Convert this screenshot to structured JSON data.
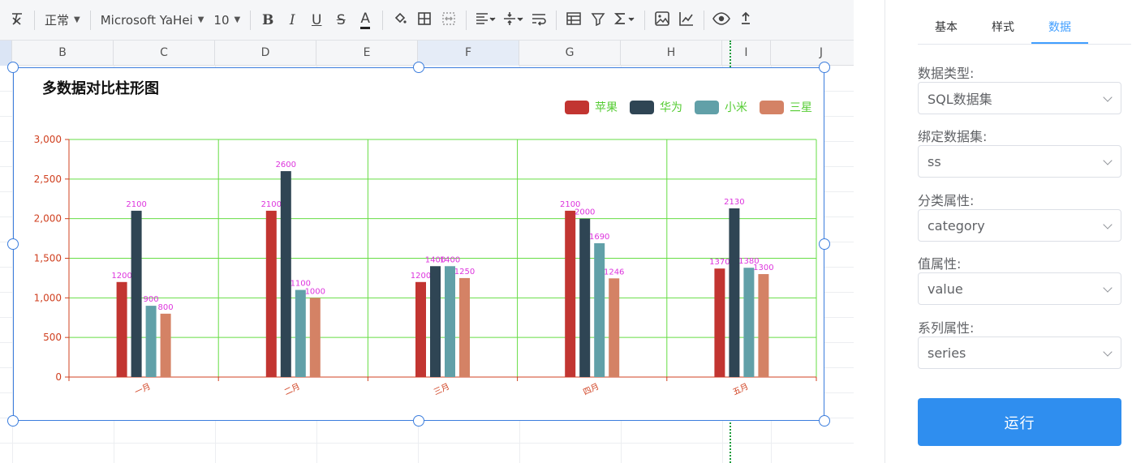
{
  "toolbar": {
    "style_value": "正常",
    "font_family_value": "Microsoft YaHei",
    "font_size_value": "10",
    "bold_label": "B",
    "italic_label": "I",
    "underline_label": "U",
    "strike_label": "S",
    "font_color_label": "A"
  },
  "columns": [
    "B",
    "C",
    "D",
    "E",
    "F",
    "G",
    "H",
    "I",
    "J"
  ],
  "panel": {
    "tabs": [
      "基本",
      "样式",
      "数据"
    ],
    "active_tab": "数据",
    "fields": [
      {
        "label": "数据类型:",
        "value": "SQL数据集"
      },
      {
        "label": "绑定数据集:",
        "value": "ss"
      },
      {
        "label": "分类属性:",
        "value": "category"
      },
      {
        "label": "值属性:",
        "value": "value"
      },
      {
        "label": "系列属性:",
        "value": "series"
      }
    ],
    "run_label": "运行"
  },
  "colors": {
    "selection": "#3b7ddd",
    "gridline": "#66dd44",
    "axis": "#d04020",
    "data_label": "#dd33dd",
    "legend_text": "#55cc33",
    "accent": "#409eff",
    "run_button": "#2f8eef"
  },
  "chart_data": {
    "type": "bar",
    "title": "多数据对比柱形图",
    "categories": [
      "一月",
      "二月",
      "三月",
      "四月",
      "五月"
    ],
    "series": [
      {
        "name": "苹果",
        "color": "#c23531",
        "values": [
          1200,
          2100,
          1200,
          2100,
          1370
        ]
      },
      {
        "name": "华为",
        "color": "#2f4554",
        "values": [
          2100,
          2600,
          1400,
          2000,
          2130
        ]
      },
      {
        "name": "小米",
        "color": "#61a0a8",
        "values": [
          900,
          1100,
          1400,
          1690,
          1380
        ]
      },
      {
        "name": "三星",
        "color": "#d48265",
        "values": [
          800,
          1000,
          1250,
          1246,
          1300
        ]
      }
    ],
    "ylim": [
      0,
      3000
    ],
    "yticks": [
      "0",
      "500",
      "1,000",
      "1,500",
      "2,000",
      "2,500",
      "3,000"
    ],
    "grid": true,
    "legend_position": "top-right"
  }
}
